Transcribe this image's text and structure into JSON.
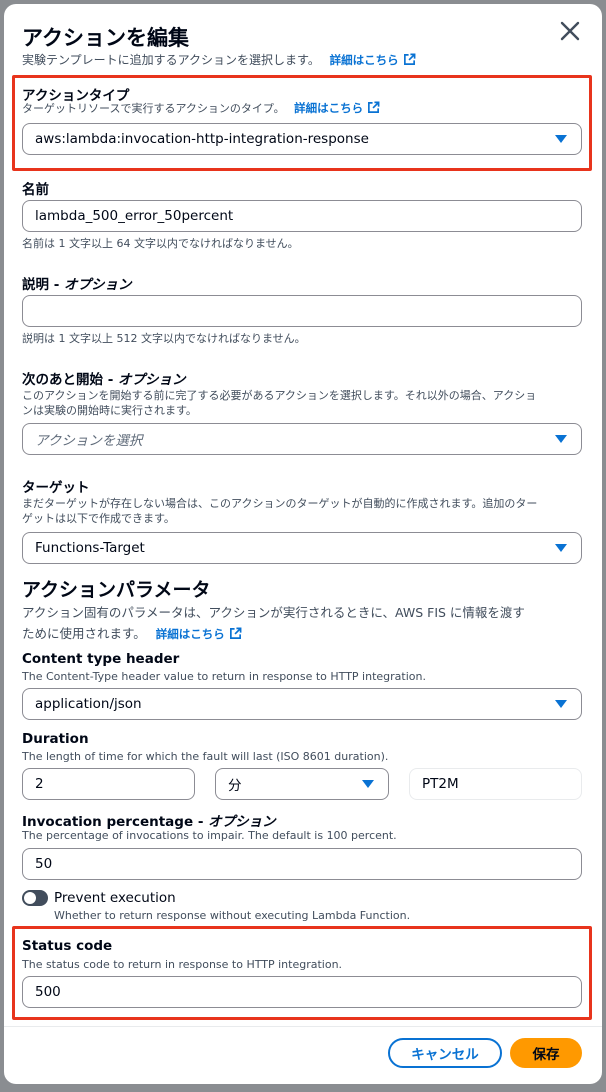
{
  "modal": {
    "title": "アクションを編集",
    "description": "実験テンプレートに追加するアクションを選択します。",
    "learn_more": "詳細はこちら"
  },
  "action_type": {
    "label": "アクションタイプ",
    "description": "ターゲットリソースで実行するアクションのタイプ。",
    "learn_more": "詳細はこちら",
    "value": "aws:lambda:invocation-http-integration-response"
  },
  "name": {
    "label": "名前",
    "value": "lambda_500_error_50percent",
    "constraint": "名前は 1 文字以上 64 文字以内でなければなりません。"
  },
  "description_field": {
    "label": "説明",
    "optional": "オプション",
    "value": "",
    "constraint": "説明は 1 文字以上 512 文字以内でなければなりません。"
  },
  "start_after": {
    "label": "次のあと開始",
    "optional": "オプション",
    "description_line1": "このアクションを開始する前に完了する必要があるアクションを選択します。それ以外の場合、アクショ",
    "description_line2": "ンは実験の開始時に実行されます。",
    "placeholder": "アクションを選択"
  },
  "target": {
    "label": "ターゲット",
    "description_line1": "まだターゲットが存在しない場合は、このアクションのターゲットが自動的に作成されます。追加のター",
    "description_line2": "ゲットは以下で作成できます。",
    "value": "Functions-Target"
  },
  "action_params": {
    "heading": "アクションパラメータ",
    "description_line1": "アクション固有のパラメータは、アクションが実行されるときに、AWS FIS に情報を渡す",
    "description_line2": "ために使用されます。",
    "learn_more": "詳細はこちら"
  },
  "content_type": {
    "label": "Content type header",
    "description": "The Content-Type header value to return in response to HTTP integration.",
    "value": "application/json"
  },
  "duration": {
    "label": "Duration",
    "description": "The length of time for which the fault will last (ISO 8601 duration).",
    "amount": "2",
    "unit": "分",
    "iso": "PT2M"
  },
  "invocation_percentage": {
    "label": "Invocation percentage",
    "optional": "オプション",
    "description": "The percentage of invocations to impair. The default is 100 percent.",
    "value": "50"
  },
  "prevent_execution": {
    "label": "Prevent execution",
    "description": "Whether to return response without executing Lambda Function.",
    "enabled": false
  },
  "status_code": {
    "label": "Status code",
    "description": "The status code to return in response to HTTP integration.",
    "value": "500"
  },
  "footer": {
    "cancel": "キャンセル",
    "save": "保存"
  },
  "colors": {
    "link": "#0972d3",
    "primary_button": "#ff9900",
    "highlight": "#e8341c"
  }
}
